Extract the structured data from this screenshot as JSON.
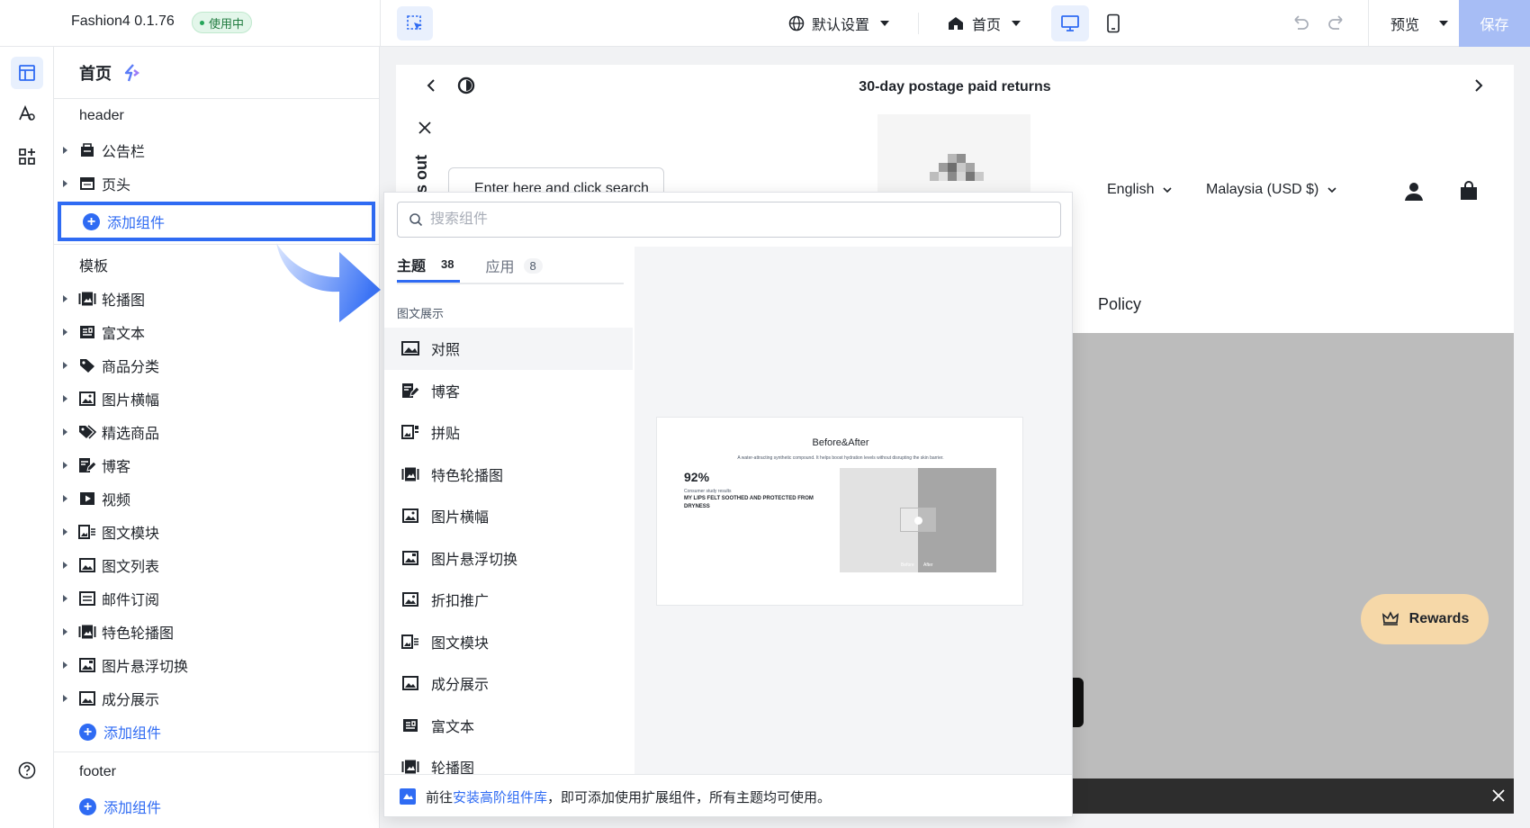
{
  "app": {
    "title": "Fashion4 0.1.76",
    "status": "使用中"
  },
  "toolbar": {
    "settings_label": "默认设置",
    "page_label": "首页",
    "preview_label": "预览",
    "save_label": "保存"
  },
  "tree": {
    "page_title": "首页",
    "header_group": "header",
    "header_items": [
      {
        "label": "公告栏",
        "icon": "announcement-icon"
      },
      {
        "label": "页头",
        "icon": "header-icon"
      }
    ],
    "add_label": "添加组件",
    "template_group": "模板",
    "template_items": [
      {
        "label": "轮播图",
        "icon": "slideshow-icon"
      },
      {
        "label": "富文本",
        "icon": "rich-text-icon"
      },
      {
        "label": "商品分类",
        "icon": "category-icon"
      },
      {
        "label": "图片横幅",
        "icon": "image-banner-icon"
      },
      {
        "label": "精选商品",
        "icon": "tag-icon"
      },
      {
        "label": "博客",
        "icon": "blog-icon"
      },
      {
        "label": "视频",
        "icon": "video-icon"
      },
      {
        "label": "图文模块",
        "icon": "image-text-icon"
      },
      {
        "label": "图文列表",
        "icon": "image-list-icon"
      },
      {
        "label": "邮件订阅",
        "icon": "mail-icon"
      },
      {
        "label": "特色轮播图",
        "icon": "slideshow-icon"
      },
      {
        "label": "图片悬浮切换",
        "icon": "image-hover-icon"
      },
      {
        "label": "成分展示",
        "icon": "ingredient-icon"
      }
    ],
    "footer_group": "footer"
  },
  "picker": {
    "search_placeholder": "搜索组件",
    "tabs": [
      {
        "label": "主题",
        "count": "38"
      },
      {
        "label": "应用",
        "count": "8"
      }
    ],
    "category": "图文展示",
    "items": [
      {
        "label": "对照",
        "icon": "compare-icon"
      },
      {
        "label": "博客",
        "icon": "blog-icon"
      },
      {
        "label": "拼贴",
        "icon": "collage-icon"
      },
      {
        "label": "特色轮播图",
        "icon": "slideshow-icon"
      },
      {
        "label": "图片横幅",
        "icon": "image-banner-icon"
      },
      {
        "label": "图片悬浮切换",
        "icon": "image-hover-icon"
      },
      {
        "label": "折扣推广",
        "icon": "discount-icon"
      },
      {
        "label": "图文模块",
        "icon": "image-text-icon"
      },
      {
        "label": "成分展示",
        "icon": "ingredient-icon"
      },
      {
        "label": "富文本",
        "icon": "rich-text-icon"
      },
      {
        "label": "轮播图",
        "icon": "slideshow-icon"
      }
    ],
    "preview": {
      "title": "Before&After",
      "subtitle": "A water-attracting synthetic compound. It helps boost hydration levels without disrupting the skin barrier.",
      "stat": "92%",
      "stat_caption": "Consumer study results",
      "stat_text": "MY LIPS FELT SOOTHED AND PROTECTED FROM DRYNESS",
      "before": "Before",
      "after": "After"
    },
    "footer_prefix": "前往",
    "footer_link": "安装高阶组件库",
    "footer_suffix": "，即可添加使用扩展组件，所有主题均可使用。"
  },
  "storefront": {
    "announcement": "30-day postage paid returns",
    "search_hint": "Enter here and click search",
    "side_text": "s out",
    "language": "English",
    "currency": "Malaysia (USD $)",
    "nav_item": "Policy",
    "rewards": "Rewards"
  },
  "colors": {
    "accent": "#2f6bf3",
    "save": "#a7bdf5",
    "rewards_bg": "#f6d8a8"
  }
}
